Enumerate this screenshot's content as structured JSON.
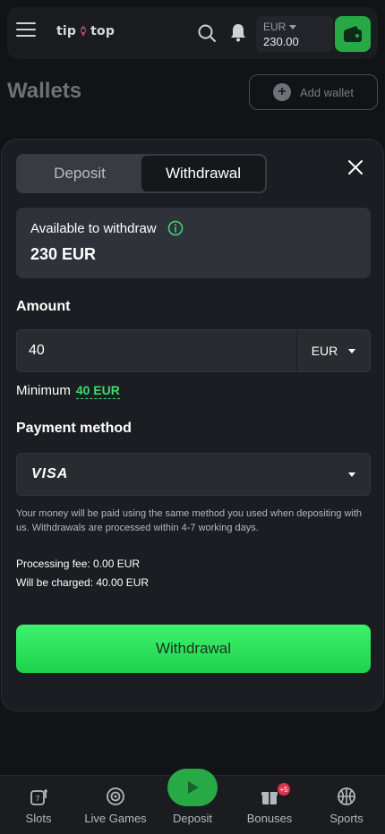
{
  "header": {
    "logo_text_left": "tip",
    "logo_text_right": "top",
    "balance_currency": "EUR",
    "balance_amount": "230.00",
    "icons": [
      "menu-icon",
      "search-icon",
      "bell-icon",
      "wallet-icon"
    ]
  },
  "page": {
    "title": "Wallets",
    "add_wallet_label": "Add wallet"
  },
  "modal": {
    "tabs": [
      {
        "label": "Deposit",
        "active": false
      },
      {
        "label": "Withdrawal",
        "active": true
      }
    ],
    "available_label": "Available to withdraw",
    "available_value": "230 EUR",
    "amount_label": "Amount",
    "amount_value": "40",
    "amount_currency": "EUR",
    "minimum_label": "Minimum",
    "minimum_value": "40 EUR",
    "payment_label": "Payment method",
    "payment_selected": "VISA",
    "note": "Your money will be paid using the same method you used when depositing with us. Withdrawals are processed within 4-7 working days.",
    "processing_fee": "Processing fee: 0.00 EUR",
    "will_be_charged": "Will be charged: 40.00 EUR",
    "submit_label": "Withdrawal"
  },
  "bottom_nav": {
    "items": [
      {
        "label": "Slots",
        "icon": "slots-icon"
      },
      {
        "label": "Live Games",
        "icon": "live-games-icon"
      },
      {
        "label": "Deposit",
        "icon": "play-icon"
      },
      {
        "label": "Bonuses",
        "icon": "gift-icon",
        "badge": "+5"
      },
      {
        "label": "Sports",
        "icon": "ball-icon"
      }
    ]
  },
  "colors": {
    "accent_green": "#27a946",
    "button_green": "#3ef26e",
    "minimum_green": "#3ddc6e",
    "background": "#121316",
    "modal": "#1c1d22"
  }
}
